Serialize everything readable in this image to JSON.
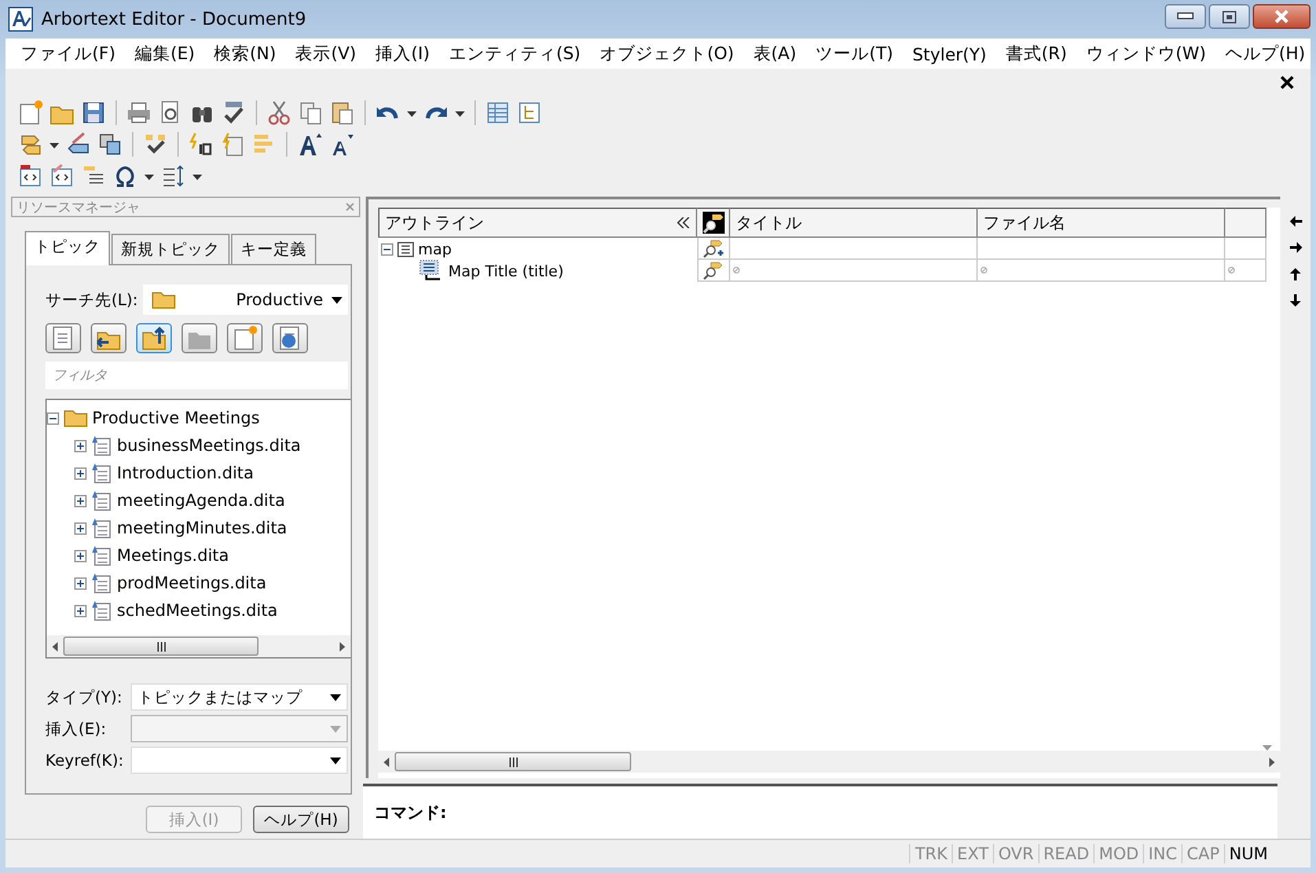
{
  "window": {
    "title": "Arbortext Editor - Document9"
  },
  "menu": [
    "ファイル(F)",
    "編集(E)",
    "検索(N)",
    "表示(V)",
    "挿入(I)",
    "エンティティ(S)",
    "オブジェクト(O)",
    "表(A)",
    "ツール(T)",
    "Styler(Y)",
    "書式(R)",
    "ウィンドウ(W)",
    "ヘルプ(H)"
  ],
  "resource_manager": {
    "title": "リソースマネージャ",
    "tabs": [
      {
        "label": "トピック",
        "selected": true
      },
      {
        "label": "新規トピック",
        "selected": false
      },
      {
        "label": "キー定義",
        "selected": false
      }
    ],
    "search_in": {
      "label": "サーチ先(L):",
      "value": "Productive"
    },
    "filter": {
      "placeholder": "フィルタ"
    },
    "tree": [
      {
        "label": "Productive Meetings",
        "expanded": true,
        "children": [
          {
            "label": "businessMeetings.dita",
            "expanded": false
          },
          {
            "label": "Introduction.dita",
            "expanded": false
          },
          {
            "label": "meetingAgenda.dita",
            "expanded": false
          },
          {
            "label": "meetingMinutes.dita",
            "expanded": false
          },
          {
            "label": "Meetings.dita",
            "expanded": false
          },
          {
            "label": "prodMeetings.dita",
            "expanded": false
          },
          {
            "label": "schedMeetings.dita",
            "expanded": false
          }
        ]
      }
    ],
    "fields": [
      {
        "label": "タイプ(Y):",
        "value": "トピックまたはマップ",
        "disabled": false
      },
      {
        "label": "挿入(E):",
        "disabled": true
      },
      {
        "label": "Keyref(K):",
        "disabled": false
      }
    ],
    "buttons": [
      {
        "label": "挿入(I)",
        "disabled": true
      },
      {
        "label": "ヘルプ(H)",
        "disabled": false
      }
    ]
  },
  "outline": {
    "columns": [
      "アウトライン",
      "タイトル",
      "ファイル名"
    ],
    "rows": [
      {
        "label": "map",
        "expanded": true,
        "children": [
          {
            "label": "Map Title (title)"
          }
        ]
      }
    ]
  },
  "command": {
    "label": "コマンド:"
  },
  "status_bar": [
    {
      "label": "TRK",
      "on": false
    },
    {
      "label": "EXT",
      "on": false
    },
    {
      "label": "OVR",
      "on": false
    },
    {
      "label": "READ",
      "on": false
    },
    {
      "label": "MOD",
      "on": false
    },
    {
      "label": "INC",
      "on": false
    },
    {
      "label": "CAP",
      "on": false
    },
    {
      "label": "NUM",
      "on": true
    }
  ]
}
